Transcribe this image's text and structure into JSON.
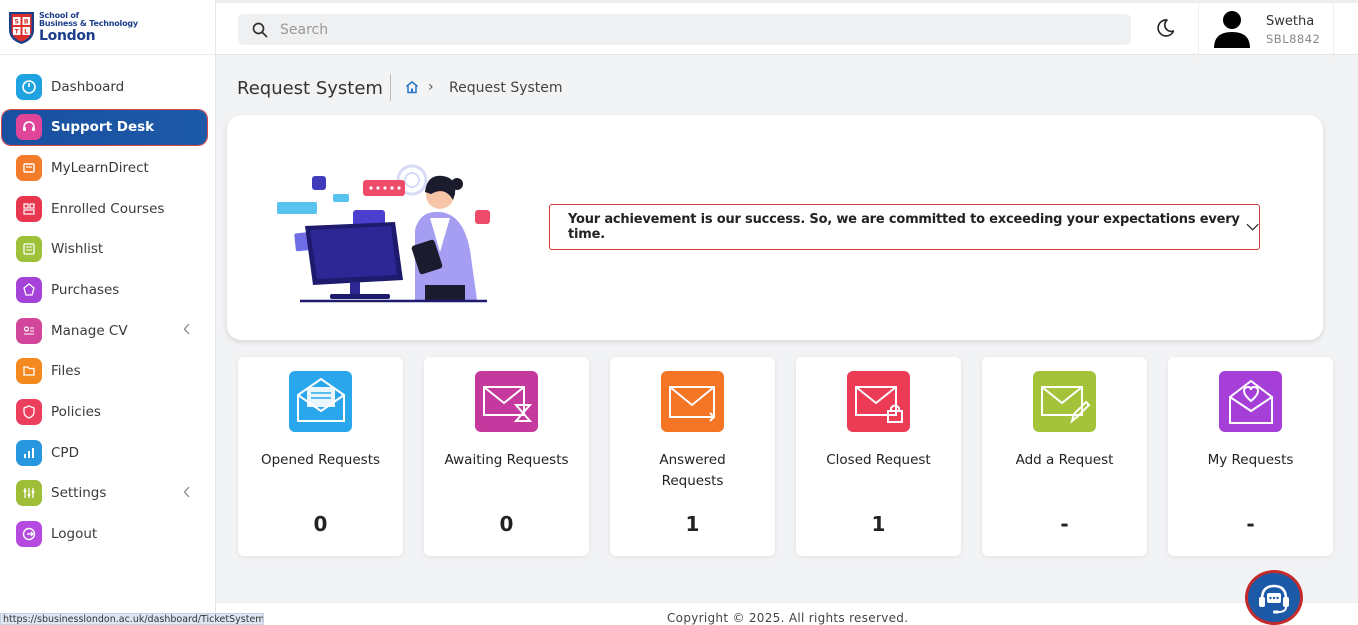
{
  "brand": {
    "line1": "School of",
    "line2": "Business & Technology",
    "line3": "London",
    "shield": "S B T L"
  },
  "sidebar": {
    "items": [
      {
        "label": "Dashboard",
        "icon": "dashboard-icon",
        "color": "#1fa3e0",
        "active": false
      },
      {
        "label": "Support Desk",
        "icon": "support-icon",
        "color": "#e0459a",
        "active": true
      },
      {
        "label": "MyLearnDirect",
        "icon": "learn-icon",
        "color": "#f47b2a",
        "active": false
      },
      {
        "label": "Enrolled Courses",
        "icon": "courses-icon",
        "color": "#e8364f",
        "active": false
      },
      {
        "label": "Wishlist",
        "icon": "wishlist-icon",
        "color": "#9dc23a",
        "active": false
      },
      {
        "label": "Purchases",
        "icon": "purchases-icon",
        "color": "#a542d8",
        "active": false
      },
      {
        "label": "Manage CV",
        "icon": "cv-icon",
        "color": "#d2479b",
        "active": false,
        "submenu": true
      },
      {
        "label": "Files",
        "icon": "files-icon",
        "color": "#f48a1f",
        "active": false
      },
      {
        "label": "Policies",
        "icon": "policies-icon",
        "color": "#ec3f5e",
        "active": false
      },
      {
        "label": "CPD",
        "icon": "cpd-icon",
        "color": "#2798e0",
        "active": false
      },
      {
        "label": "Settings",
        "icon": "settings-icon",
        "color": "#9ebe37",
        "active": false,
        "submenu": true
      },
      {
        "label": "Logout",
        "icon": "logout-icon",
        "color": "#b44ae0",
        "active": false
      }
    ]
  },
  "header": {
    "search_placeholder": "Search",
    "user_name": "Swetha",
    "user_id": "SBL8842"
  },
  "page": {
    "title": "Request System",
    "breadcrumb_current": "Request System",
    "motto": "Your achievement is our success. So, we are committed to exceeding your expectations every time."
  },
  "cards": [
    {
      "title": "Opened Requests",
      "value": "0",
      "icon": "envelope-open-icon",
      "color": "#2aa7ec"
    },
    {
      "title": "Awaiting Requests",
      "value": "0",
      "icon": "envelope-hourglass-icon",
      "color": "#c5389e"
    },
    {
      "title": "Answered Requests",
      "value": "1",
      "icon": "envelope-reply-icon",
      "color": "#f47524"
    },
    {
      "title": "Closed Request",
      "value": "1",
      "icon": "envelope-lock-icon",
      "color": "#ec3b55"
    },
    {
      "title": "Add a Request",
      "value": "-",
      "icon": "envelope-edit-icon",
      "color": "#a5c33a"
    },
    {
      "title": "My Requests",
      "value": "-",
      "icon": "envelope-heart-icon",
      "color": "#a53fd8"
    }
  ],
  "footer": {
    "copyright": "Copyright © 2025. All rights reserved."
  },
  "status_url": "https://sbusinesslondon.ac.uk/dashboard/TicketSystem"
}
